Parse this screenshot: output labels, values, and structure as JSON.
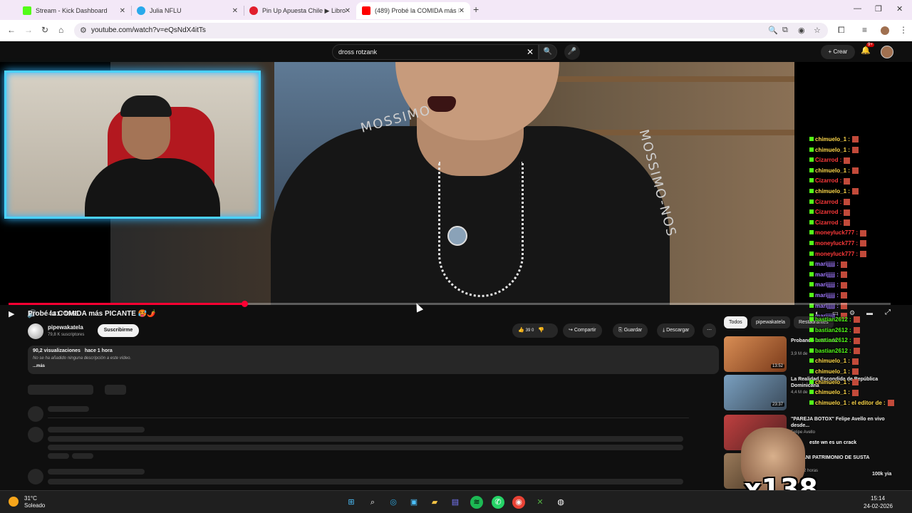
{
  "browser": {
    "tabs": [
      {
        "label": "Stream - Kick Dashboard",
        "color": "#53fc18"
      },
      {
        "label": "Julia NFLU",
        "color": "#29a9eb"
      },
      {
        "label": "Pin Up Apuesta Chile ▶ Libro",
        "color": "#e11d2c"
      },
      {
        "label": "(489) Probé la COMIDA más PIC",
        "color": "#ff0000"
      }
    ],
    "url": "youtube.com/watch?v=eQsNdX4itTs"
  },
  "youtube": {
    "search_value": "dross rotzank",
    "create_label": "Crear",
    "bell_badge": "9+"
  },
  "player": {
    "time": "4:31 / 16:55",
    "progress": 0.267,
    "shirt_text": "MOSSIMO",
    "shirt_text_2": "SIMO·NOS",
    "shirt_text_3": "MOSSIMO-NOS",
    "chat": [
      {
        "user": "chimuelo_1",
        "color": "#ffd84a"
      },
      {
        "user": "chimuelo_1",
        "color": "#ffd84a"
      },
      {
        "user": "Cizarrod",
        "color": "#ff3a3a"
      },
      {
        "user": "chimuelo_1",
        "color": "#ffd84a"
      },
      {
        "user": "Cizarrod",
        "color": "#ff3a3a"
      },
      {
        "user": "chimuelo_1",
        "color": "#ffd84a"
      },
      {
        "user": "Cizarrod",
        "color": "#ff3a3a"
      },
      {
        "user": "Cizarrod",
        "color": "#ff3a3a"
      },
      {
        "user": "Cizarrod",
        "color": "#ff3a3a"
      },
      {
        "user": "moneyluck777",
        "color": "#ff3a3a"
      },
      {
        "user": "moneyluck777",
        "color": "#ff3a3a"
      },
      {
        "user": "moneyluck777",
        "color": "#ff3a3a"
      },
      {
        "user": "marijjjjj",
        "color": "#a078ff"
      },
      {
        "user": "marijjjjj",
        "color": "#a078ff"
      },
      {
        "user": "marijjjjj",
        "color": "#a078ff"
      },
      {
        "user": "marijjjjj",
        "color": "#a078ff"
      },
      {
        "user": "marijjjjj",
        "color": "#a078ff"
      },
      {
        "user": "marijjjjj",
        "color": "#a078ff"
      }
    ]
  },
  "video": {
    "title": "Probé la COMIDA más PICANTE 🥵🌶️",
    "channel": "pipewakatela",
    "subscribers": "79,8 K suscriptores",
    "subscribe_label": "Suscribirme",
    "likes": "39 0",
    "share_label": "Compartir",
    "save_label": "Guardar",
    "download_label": "Descargar",
    "views": "90,2 visualizaciones",
    "age": "hace 1 hora",
    "no_desc": "No se ha añadido ninguna descripción a este vídeo.",
    "more": "...más"
  },
  "sidebar": {
    "chips": [
      "Todos",
      "pipewakatela",
      "Restaurantes"
    ],
    "recs": [
      {
        "title": "Probando la Mundo",
        "meta": "3,9 M de",
        "duration": "13:52",
        "color": "#c97a4a"
      },
      {
        "title": "La Realidad Escondida de República Dominicana",
        "meta": "4,4 M de",
        "duration": "23:37",
        "color": "#6a8fb0"
      },
      {
        "title": "\"PAREJA BOTOX\" Felipe Avello en vivo desde...",
        "meta": "Felipe Avello",
        "duration": "",
        "color": "#b04040"
      },
      {
        "title": "ARMANI PATRIMONIO DE SUSTA",
        "meta": "hace 22 horas",
        "duration": "",
        "color": "#8a6a4a"
      }
    ],
    "chat_lower": [
      {
        "user": "bastian2612",
        "color": "#53fc18"
      },
      {
        "user": "bastian2612",
        "color": "#53fc18"
      },
      {
        "user": "bastian2612",
        "color": "#53fc18"
      },
      {
        "user": "bastian2612",
        "color": "#53fc18"
      },
      {
        "user": "chimuelo_1",
        "color": "#ffd84a"
      },
      {
        "user": "chimuelo_1",
        "color": "#ffd84a"
      },
      {
        "user": "chimuelo_1",
        "color": "#ffd84a"
      },
      {
        "user": "chimuelo_1",
        "color": "#ffd84a"
      },
      {
        "user": "chimuelo_1 : el editor de",
        "color": "#ffd84a"
      }
    ]
  },
  "overlay": {
    "multiplier": "x138",
    "caption": "este wn es un crack",
    "caption2": "100k yia"
  },
  "taskbar": {
    "temp": "31°C",
    "weather": "Soleado",
    "time": "15:14",
    "date": "24-02-2026"
  }
}
